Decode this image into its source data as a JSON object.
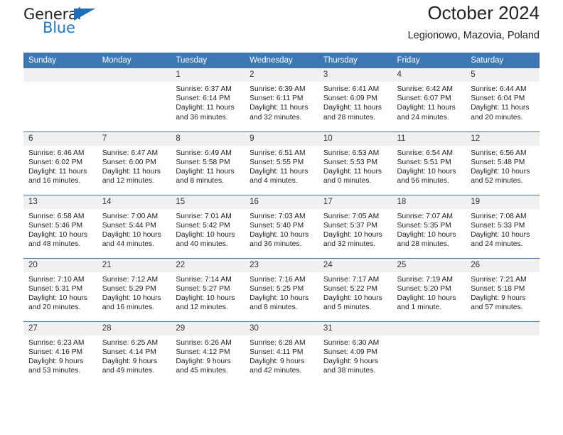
{
  "brand": {
    "name_top": "General",
    "name_bottom": "Blue",
    "accent_color": "#1f6fb8",
    "triangle_icon": "triangle-icon"
  },
  "header": {
    "title": "October 2024",
    "location": "Legionowo, Mazovia, Poland"
  },
  "theme": {
    "header_blue": "#3b78b5",
    "daynum_background": "#f0f0f0",
    "text_color": "#222222"
  },
  "weekdays": [
    "Sunday",
    "Monday",
    "Tuesday",
    "Wednesday",
    "Thursday",
    "Friday",
    "Saturday"
  ],
  "weeks": [
    [
      {
        "day": "",
        "sunrise": "",
        "sunset": "",
        "daylight_line1": "",
        "daylight_line2": ""
      },
      {
        "day": "",
        "sunrise": "",
        "sunset": "",
        "daylight_line1": "",
        "daylight_line2": ""
      },
      {
        "day": "1",
        "sunrise": "Sunrise: 6:37 AM",
        "sunset": "Sunset: 6:14 PM",
        "daylight_line1": "Daylight: 11 hours",
        "daylight_line2": "and 36 minutes."
      },
      {
        "day": "2",
        "sunrise": "Sunrise: 6:39 AM",
        "sunset": "Sunset: 6:11 PM",
        "daylight_line1": "Daylight: 11 hours",
        "daylight_line2": "and 32 minutes."
      },
      {
        "day": "3",
        "sunrise": "Sunrise: 6:41 AM",
        "sunset": "Sunset: 6:09 PM",
        "daylight_line1": "Daylight: 11 hours",
        "daylight_line2": "and 28 minutes."
      },
      {
        "day": "4",
        "sunrise": "Sunrise: 6:42 AM",
        "sunset": "Sunset: 6:07 PM",
        "daylight_line1": "Daylight: 11 hours",
        "daylight_line2": "and 24 minutes."
      },
      {
        "day": "5",
        "sunrise": "Sunrise: 6:44 AM",
        "sunset": "Sunset: 6:04 PM",
        "daylight_line1": "Daylight: 11 hours",
        "daylight_line2": "and 20 minutes."
      }
    ],
    [
      {
        "day": "6",
        "sunrise": "Sunrise: 6:46 AM",
        "sunset": "Sunset: 6:02 PM",
        "daylight_line1": "Daylight: 11 hours",
        "daylight_line2": "and 16 minutes."
      },
      {
        "day": "7",
        "sunrise": "Sunrise: 6:47 AM",
        "sunset": "Sunset: 6:00 PM",
        "daylight_line1": "Daylight: 11 hours",
        "daylight_line2": "and 12 minutes."
      },
      {
        "day": "8",
        "sunrise": "Sunrise: 6:49 AM",
        "sunset": "Sunset: 5:58 PM",
        "daylight_line1": "Daylight: 11 hours",
        "daylight_line2": "and 8 minutes."
      },
      {
        "day": "9",
        "sunrise": "Sunrise: 6:51 AM",
        "sunset": "Sunset: 5:55 PM",
        "daylight_line1": "Daylight: 11 hours",
        "daylight_line2": "and 4 minutes."
      },
      {
        "day": "10",
        "sunrise": "Sunrise: 6:53 AM",
        "sunset": "Sunset: 5:53 PM",
        "daylight_line1": "Daylight: 11 hours",
        "daylight_line2": "and 0 minutes."
      },
      {
        "day": "11",
        "sunrise": "Sunrise: 6:54 AM",
        "sunset": "Sunset: 5:51 PM",
        "daylight_line1": "Daylight: 10 hours",
        "daylight_line2": "and 56 minutes."
      },
      {
        "day": "12",
        "sunrise": "Sunrise: 6:56 AM",
        "sunset": "Sunset: 5:48 PM",
        "daylight_line1": "Daylight: 10 hours",
        "daylight_line2": "and 52 minutes."
      }
    ],
    [
      {
        "day": "13",
        "sunrise": "Sunrise: 6:58 AM",
        "sunset": "Sunset: 5:46 PM",
        "daylight_line1": "Daylight: 10 hours",
        "daylight_line2": "and 48 minutes."
      },
      {
        "day": "14",
        "sunrise": "Sunrise: 7:00 AM",
        "sunset": "Sunset: 5:44 PM",
        "daylight_line1": "Daylight: 10 hours",
        "daylight_line2": "and 44 minutes."
      },
      {
        "day": "15",
        "sunrise": "Sunrise: 7:01 AM",
        "sunset": "Sunset: 5:42 PM",
        "daylight_line1": "Daylight: 10 hours",
        "daylight_line2": "and 40 minutes."
      },
      {
        "day": "16",
        "sunrise": "Sunrise: 7:03 AM",
        "sunset": "Sunset: 5:40 PM",
        "daylight_line1": "Daylight: 10 hours",
        "daylight_line2": "and 36 minutes."
      },
      {
        "day": "17",
        "sunrise": "Sunrise: 7:05 AM",
        "sunset": "Sunset: 5:37 PM",
        "daylight_line1": "Daylight: 10 hours",
        "daylight_line2": "and 32 minutes."
      },
      {
        "day": "18",
        "sunrise": "Sunrise: 7:07 AM",
        "sunset": "Sunset: 5:35 PM",
        "daylight_line1": "Daylight: 10 hours",
        "daylight_line2": "and 28 minutes."
      },
      {
        "day": "19",
        "sunrise": "Sunrise: 7:08 AM",
        "sunset": "Sunset: 5:33 PM",
        "daylight_line1": "Daylight: 10 hours",
        "daylight_line2": "and 24 minutes."
      }
    ],
    [
      {
        "day": "20",
        "sunrise": "Sunrise: 7:10 AM",
        "sunset": "Sunset: 5:31 PM",
        "daylight_line1": "Daylight: 10 hours",
        "daylight_line2": "and 20 minutes."
      },
      {
        "day": "21",
        "sunrise": "Sunrise: 7:12 AM",
        "sunset": "Sunset: 5:29 PM",
        "daylight_line1": "Daylight: 10 hours",
        "daylight_line2": "and 16 minutes."
      },
      {
        "day": "22",
        "sunrise": "Sunrise: 7:14 AM",
        "sunset": "Sunset: 5:27 PM",
        "daylight_line1": "Daylight: 10 hours",
        "daylight_line2": "and 12 minutes."
      },
      {
        "day": "23",
        "sunrise": "Sunrise: 7:16 AM",
        "sunset": "Sunset: 5:25 PM",
        "daylight_line1": "Daylight: 10 hours",
        "daylight_line2": "and 8 minutes."
      },
      {
        "day": "24",
        "sunrise": "Sunrise: 7:17 AM",
        "sunset": "Sunset: 5:22 PM",
        "daylight_line1": "Daylight: 10 hours",
        "daylight_line2": "and 5 minutes."
      },
      {
        "day": "25",
        "sunrise": "Sunrise: 7:19 AM",
        "sunset": "Sunset: 5:20 PM",
        "daylight_line1": "Daylight: 10 hours",
        "daylight_line2": "and 1 minute."
      },
      {
        "day": "26",
        "sunrise": "Sunrise: 7:21 AM",
        "sunset": "Sunset: 5:18 PM",
        "daylight_line1": "Daylight: 9 hours",
        "daylight_line2": "and 57 minutes."
      }
    ],
    [
      {
        "day": "27",
        "sunrise": "Sunrise: 6:23 AM",
        "sunset": "Sunset: 4:16 PM",
        "daylight_line1": "Daylight: 9 hours",
        "daylight_line2": "and 53 minutes."
      },
      {
        "day": "28",
        "sunrise": "Sunrise: 6:25 AM",
        "sunset": "Sunset: 4:14 PM",
        "daylight_line1": "Daylight: 9 hours",
        "daylight_line2": "and 49 minutes."
      },
      {
        "day": "29",
        "sunrise": "Sunrise: 6:26 AM",
        "sunset": "Sunset: 4:12 PM",
        "daylight_line1": "Daylight: 9 hours",
        "daylight_line2": "and 45 minutes."
      },
      {
        "day": "30",
        "sunrise": "Sunrise: 6:28 AM",
        "sunset": "Sunset: 4:11 PM",
        "daylight_line1": "Daylight: 9 hours",
        "daylight_line2": "and 42 minutes."
      },
      {
        "day": "31",
        "sunrise": "Sunrise: 6:30 AM",
        "sunset": "Sunset: 4:09 PM",
        "daylight_line1": "Daylight: 9 hours",
        "daylight_line2": "and 38 minutes."
      },
      {
        "day": "",
        "sunrise": "",
        "sunset": "",
        "daylight_line1": "",
        "daylight_line2": ""
      },
      {
        "day": "",
        "sunrise": "",
        "sunset": "",
        "daylight_line1": "",
        "daylight_line2": ""
      }
    ]
  ]
}
